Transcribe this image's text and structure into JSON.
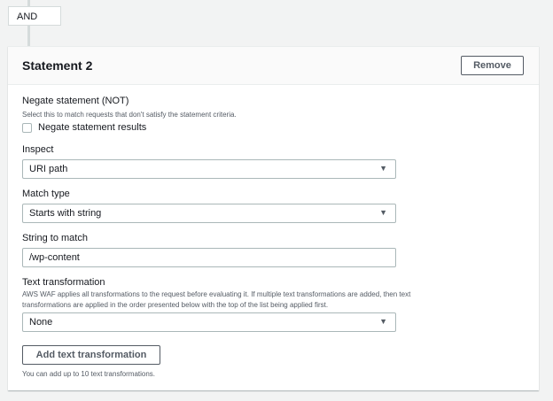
{
  "connector": {
    "label": "AND"
  },
  "statement": {
    "title": "Statement 2",
    "remove_label": "Remove"
  },
  "negate": {
    "label": "Negate statement (NOT)",
    "description": "Select this to match requests that don't satisfy the statement criteria.",
    "checkbox_label": "Negate statement results",
    "checked": false
  },
  "inspect": {
    "label": "Inspect",
    "value": "URI path"
  },
  "match_type": {
    "label": "Match type",
    "value": "Starts with string"
  },
  "string_to_match": {
    "label": "String to match",
    "value": "/wp-content"
  },
  "text_transformation": {
    "label": "Text transformation",
    "description": "AWS WAF applies all transformations to the request before evaluating it. If multiple text transformations are added, then text transformations are applied in the order presented below with the top of the list being applied first.",
    "value": "None",
    "add_label": "Add text transformation",
    "note": "You can add up to 10 text transformations."
  }
}
